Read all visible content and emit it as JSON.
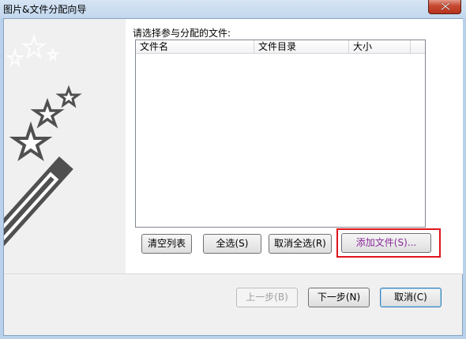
{
  "window": {
    "title": "图片&文件分配向导"
  },
  "content": {
    "prompt": "请选择参与分配的文件:",
    "columns": [
      "文件名",
      "文件目录",
      "大小"
    ]
  },
  "list_buttons": {
    "clear": "清空列表",
    "select_all": "全选(S)",
    "deselect_all": "取消全选(R)",
    "add_files": "添加文件(S)..."
  },
  "nav_buttons": {
    "back": "上一步(B)",
    "next": "下一步(N)",
    "cancel": "取消(C)"
  },
  "colors": {
    "highlight_border": "#e0141b",
    "highlight_text": "#8a2b9b"
  }
}
